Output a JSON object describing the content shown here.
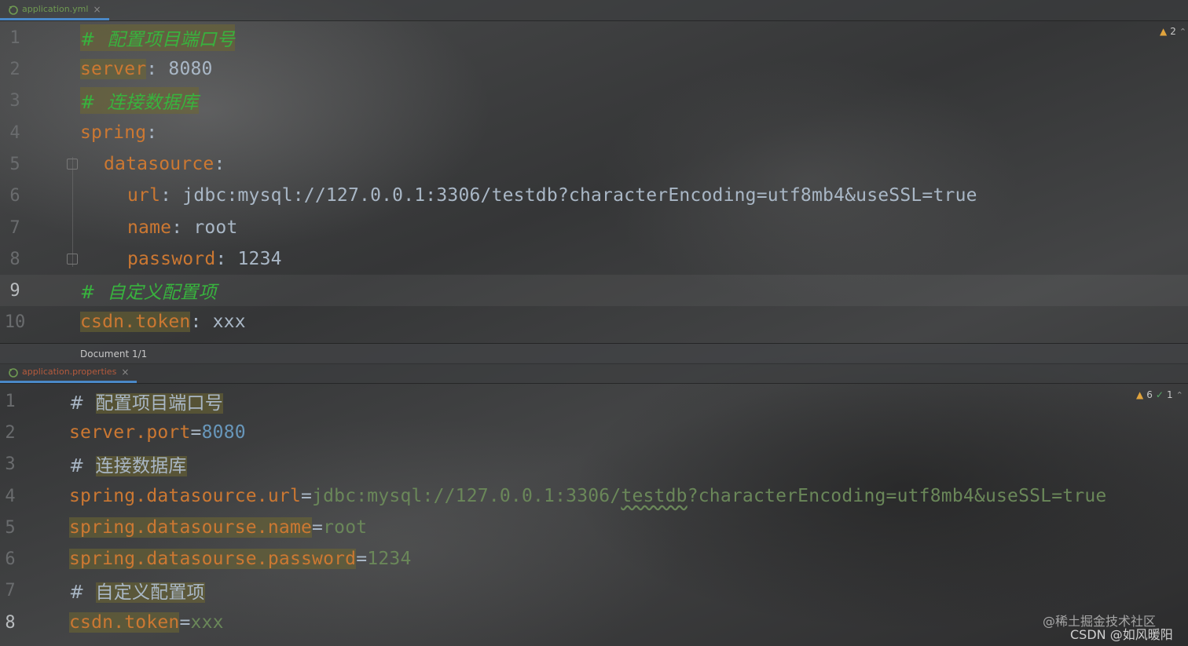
{
  "yaml_editor": {
    "tab_label": "application.yml",
    "tab_close": "×",
    "inspection_warnings": "2",
    "status_label": "Document 1/1",
    "lines": [
      {
        "no": "1",
        "comment": "#  配置项目端口号"
      },
      {
        "no": "2",
        "key": "server",
        "sep": ": ",
        "value": "8080"
      },
      {
        "no": "3",
        "comment": "#  连接数据库"
      },
      {
        "no": "4",
        "key": "spring",
        "sep": ":"
      },
      {
        "no": "5",
        "key": "datasource",
        "sep": ":"
      },
      {
        "no": "6",
        "key": "url",
        "sep": ": ",
        "value": "jdbc:mysql://127.0.0.1:3306/testdb?characterEncoding=utf8mb4&useSSL=true"
      },
      {
        "no": "7",
        "key": "name",
        "sep": ": ",
        "value": "root"
      },
      {
        "no": "8",
        "key": "password",
        "sep": ": ",
        "value": "1234"
      },
      {
        "no": "9",
        "comment": "#  自定义配置项"
      },
      {
        "no": "10",
        "key": "csdn.token",
        "sep": ": ",
        "value": "xxx"
      }
    ]
  },
  "properties_editor": {
    "tab_label": "application.properties",
    "tab_close": "×",
    "inspection_warnings": "6",
    "inspection_ok": "1",
    "lines": [
      {
        "no": "1",
        "hash": "#",
        "comment": "配置项目端口号"
      },
      {
        "no": "2",
        "key": "server.port",
        "eq": "=",
        "value": "8080"
      },
      {
        "no": "3",
        "hash": "#",
        "comment": "连接数据库"
      },
      {
        "no": "4",
        "key": "spring.datasource.url",
        "eq": "=",
        "value_a": "jdbc:mysql://127.0.0.1:3306/",
        "value_b": "testdb",
        "value_c": "?characterEncoding=utf8mb4&useSSL=true"
      },
      {
        "no": "5",
        "key": "spring.datasourse.name",
        "eq": "=",
        "value": "root"
      },
      {
        "no": "6",
        "key": "spring.datasourse.password",
        "eq": "=",
        "value": "1234"
      },
      {
        "no": "7",
        "hash": "#",
        "comment": "自定义配置项"
      },
      {
        "no": "8",
        "key": "csdn.token",
        "eq": "=",
        "value": "xxx"
      }
    ]
  },
  "watermark": {
    "line1": "@稀土掘金技术社区",
    "line2": "CSDN @如风暖阳"
  },
  "icons": {
    "warning": "warning-triangle-icon",
    "ok": "check-icon",
    "file": "yaml-file-icon"
  },
  "colors": {
    "key": "#cc7832",
    "value": "#a9b7c6",
    "comment_yaml": "#38b33e",
    "number": "#6897bb",
    "prop_value": "#6a8759",
    "tab_accent": "#4a88c7"
  }
}
